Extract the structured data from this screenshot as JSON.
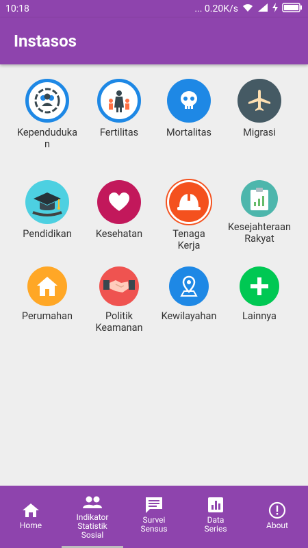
{
  "status": {
    "time": "10:18",
    "net": "... 0.20K/s"
  },
  "app": {
    "title": "Instasos"
  },
  "grid": [
    {
      "label": "Kependuduka\nn",
      "icon": "population-icon"
    },
    {
      "label": "Fertilitas",
      "icon": "family-icon"
    },
    {
      "label": "Mortalitas",
      "icon": "skull-icon"
    },
    {
      "label": "Migrasi",
      "icon": "airplane-icon"
    },
    {
      "label": "Pendidikan",
      "icon": "graduation-cap-icon"
    },
    {
      "label": "Kesehatan",
      "icon": "heart-icon"
    },
    {
      "label": "Tenaga\nKerja",
      "icon": "hard-hat-icon"
    },
    {
      "label": "Kesejahteraan\nRakyat",
      "icon": "clipboard-chart-icon"
    },
    {
      "label": "Perumahan",
      "icon": "house-icon"
    },
    {
      "label": "Politik\nKeamanan",
      "icon": "handshake-icon"
    },
    {
      "label": "Kewilayahan",
      "icon": "map-pin-icon"
    },
    {
      "label": "Lainnya",
      "icon": "plus-icon"
    }
  ],
  "nav": [
    {
      "label": "Home",
      "icon": "home-icon"
    },
    {
      "label": "Indikator\nStatistik\nSosial",
      "icon": "people-icon"
    },
    {
      "label": "Survei\nSensus",
      "icon": "message-icon"
    },
    {
      "label": "Data\nSeries",
      "icon": "bar-chart-icon"
    },
    {
      "label": "About",
      "icon": "info-icon"
    }
  ]
}
